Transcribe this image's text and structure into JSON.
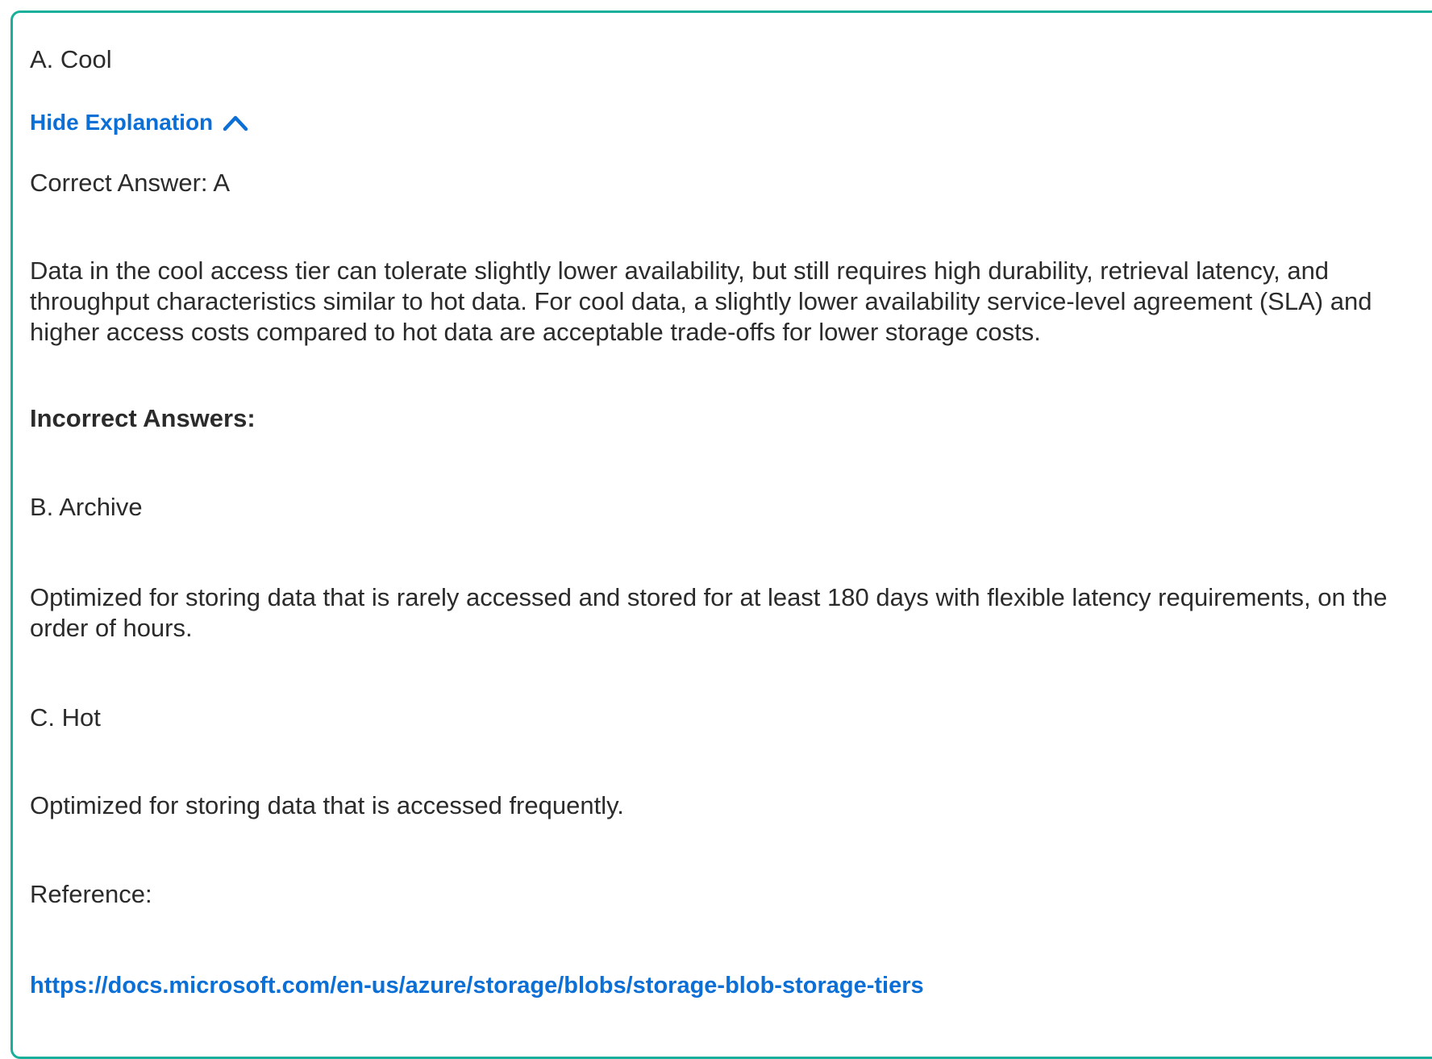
{
  "answer": {
    "selected_option": "A. Cool"
  },
  "explanation": {
    "toggle_label": "Hide Explanation",
    "toggle_icon": "chevron-up-icon",
    "correct_answer": "Correct Answer: A",
    "correct_paragraph": "Data in the cool access tier can tolerate slightly lower availability, but still requires high durability, retrieval latency, and throughput characteristics similar to hot data. For cool data, a slightly lower availability service-level agreement (SLA) and higher access costs compared to hot data are acceptable trade-offs for lower storage costs.",
    "incorrect_heading": "Incorrect Answers:",
    "incorrect": [
      {
        "option": "B. Archive",
        "text": "Optimized for storing data that is rarely accessed and stored for at least 180 days with flexible latency requirements, on the order of hours."
      },
      {
        "option": "C. Hot",
        "text": "Optimized for storing data that is accessed frequently."
      }
    ],
    "reference_label": "Reference:",
    "reference_url": "https://docs.microsoft.com/en-us/azure/storage/blobs/storage-blob-storage-tiers"
  },
  "colors": {
    "border": "#19b09b",
    "link": "#0b6fd6",
    "text": "#2b2b2b"
  }
}
